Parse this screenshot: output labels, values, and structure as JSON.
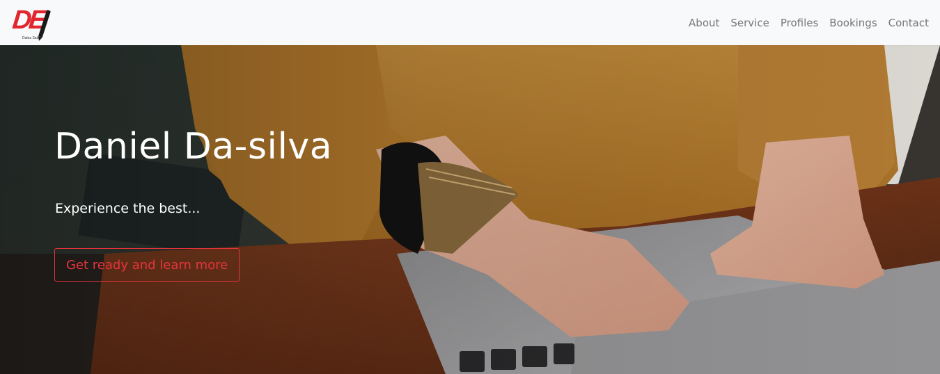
{
  "brand": {
    "logo_text": "DE",
    "logo_caption": "Dalea Sale",
    "brand_color": "#e2262e",
    "icon": "pen-icon"
  },
  "nav": {
    "items": [
      {
        "label": "About"
      },
      {
        "label": "Service"
      },
      {
        "label": "Profiles"
      },
      {
        "label": "Bookings"
      },
      {
        "label": "Contact"
      }
    ]
  },
  "hero": {
    "title": "Daniel Da-silva",
    "subtitle": "Experience the best...",
    "cta_label": "Get ready and learn more",
    "cta_color": "#e8333b",
    "background": "photo-person-typing-laptop"
  }
}
